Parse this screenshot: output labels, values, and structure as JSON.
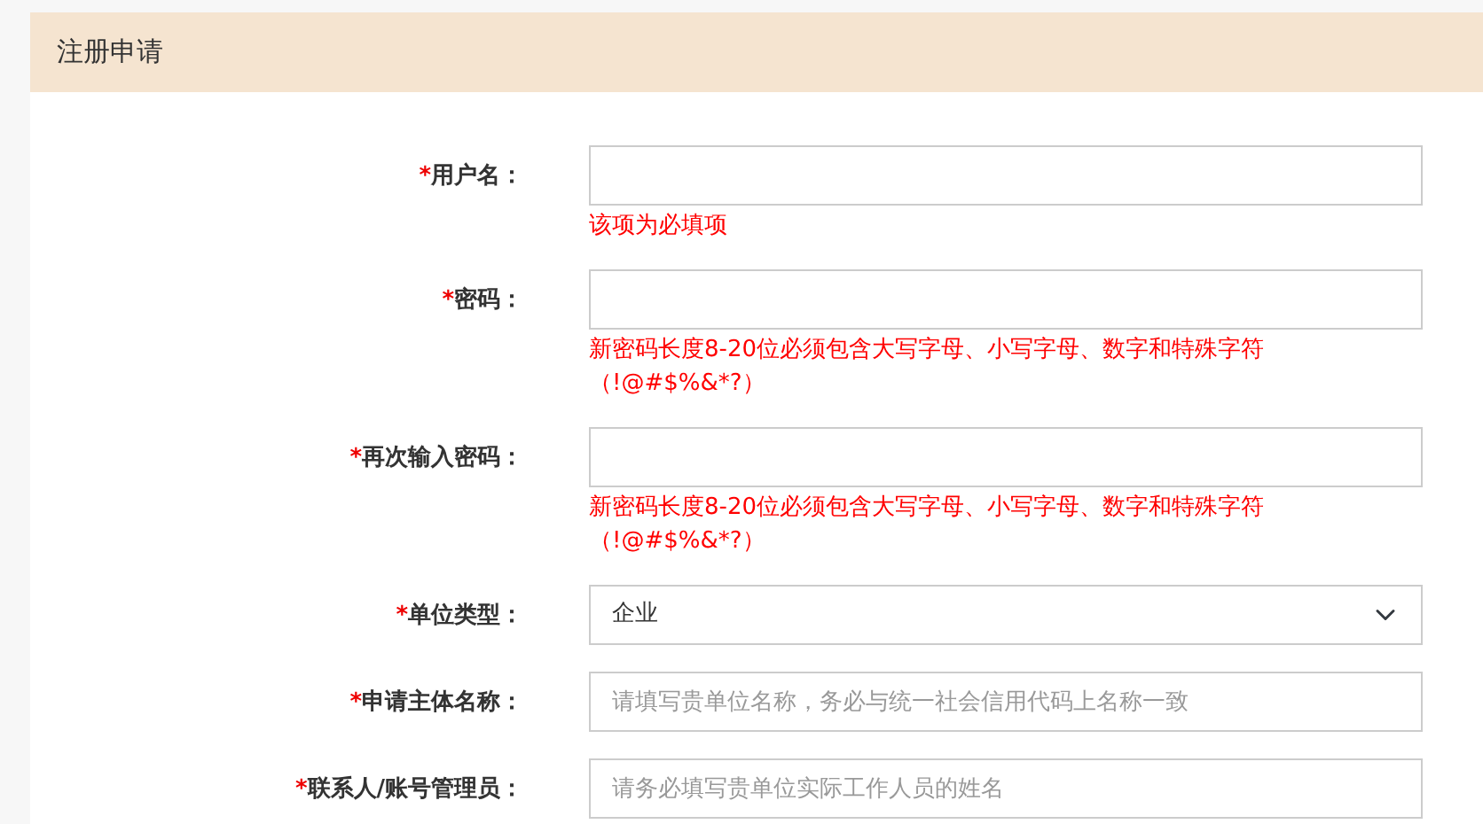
{
  "panel": {
    "title": "注册申请"
  },
  "fields": [
    {
      "kind": "text",
      "required_mark": "*",
      "label": "用户名：",
      "error": "该项为必填项"
    },
    {
      "kind": "text",
      "required_mark": "*",
      "label": "密码：",
      "error": "新密码长度8-20位必须包含大写字母、小写字母、数字和特殊字符（!@#$%&*?）"
    },
    {
      "kind": "text",
      "required_mark": "*",
      "label": "再次输入密码：",
      "error": "新密码长度8-20位必须包含大写字母、小写字母、数字和特殊字符（!@#$%&*?）"
    },
    {
      "kind": "select",
      "required_mark": "*",
      "label": "单位类型：",
      "value": "企业"
    },
    {
      "kind": "text",
      "required_mark": "*",
      "label": "申请主体名称：",
      "placeholder": "请填写贵单位名称，务必与统一社会信用代码上名称一致"
    },
    {
      "kind": "text",
      "required_mark": "*",
      "label": "联系人/账号管理员：",
      "placeholder": "请务必填写贵单位实际工作人员的姓名"
    }
  ]
}
